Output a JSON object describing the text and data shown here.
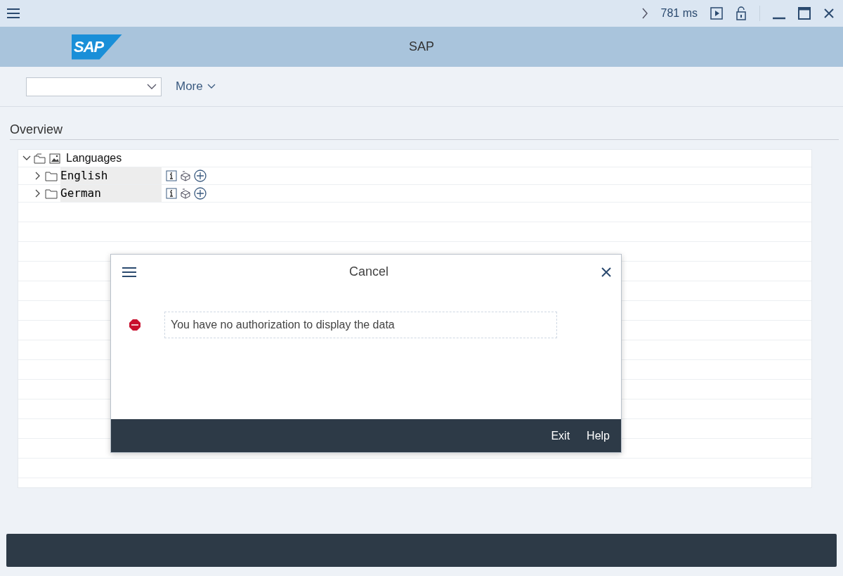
{
  "top_bar": {
    "response_time": "781 ms"
  },
  "header": {
    "logo": "SAP",
    "title": "SAP"
  },
  "toolbar": {
    "more_label": "More"
  },
  "section_title": "Overview",
  "tree": [
    {
      "label": "Languages",
      "expanded": true,
      "children": [
        {
          "label": "English",
          "expanded": false
        },
        {
          "label": "German",
          "expanded": false
        }
      ]
    }
  ],
  "dialog": {
    "title": "Cancel",
    "message": "You have no authorization to display the data",
    "buttons": [
      "Exit",
      "Help"
    ]
  }
}
